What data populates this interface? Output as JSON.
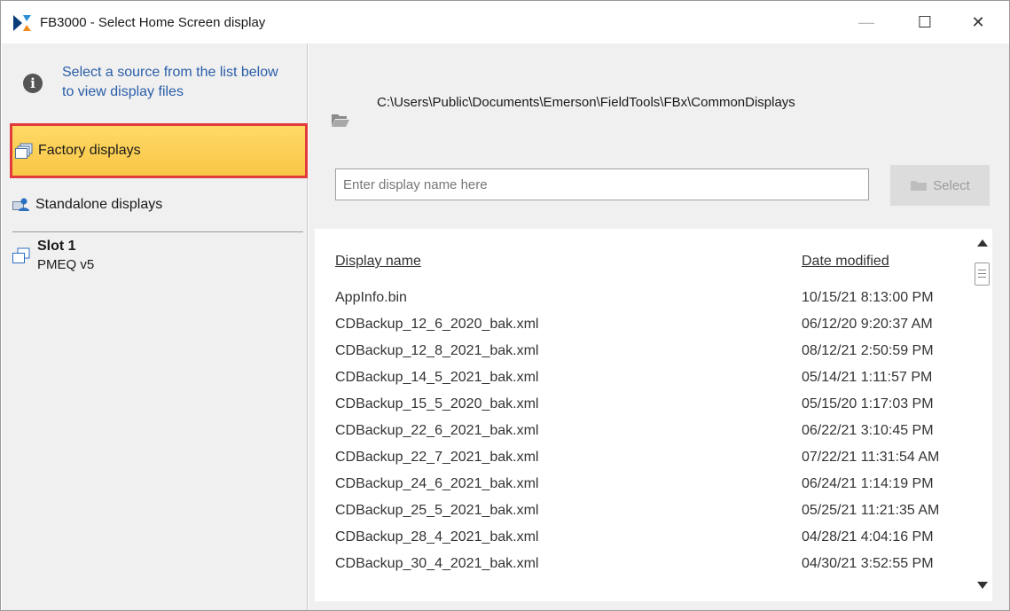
{
  "window": {
    "title": "FB3000 - Select Home Screen display",
    "logo_icon": "emerson-fb-logo-icon",
    "controls": {
      "minimize": "—",
      "maximize": "☐",
      "close": "✕"
    }
  },
  "sidebar": {
    "info_text": "Select a source from the list below to view display files",
    "info_icon": "info-icon",
    "items": [
      {
        "label": "Factory displays",
        "icon": "stacked-windows-icon",
        "selected": true
      },
      {
        "label": "Standalone displays",
        "icon": "user-display-icon",
        "selected": false
      }
    ],
    "slot": {
      "title": "Slot 1",
      "subtitle": "PMEQ v5",
      "icon": "stacked-windows-icon"
    }
  },
  "main": {
    "path": "C:\\Users\\Public\\Documents\\Emerson\\FieldTools\\FBx\\CommonDisplays",
    "search": {
      "placeholder": "Enter display name here",
      "value": ""
    },
    "select_button": {
      "label": "Select",
      "enabled": false
    },
    "columns": {
      "name": "Display name",
      "date": "Date modified"
    },
    "files": [
      {
        "name": "AppInfo.bin",
        "date": "10/15/21 8:13:00 PM"
      },
      {
        "name": "CDBackup_12_6_2020_bak.xml",
        "date": "06/12/20 9:20:37 AM"
      },
      {
        "name": "CDBackup_12_8_2021_bak.xml",
        "date": "08/12/21 2:50:59 PM"
      },
      {
        "name": "CDBackup_14_5_2021_bak.xml",
        "date": "05/14/21 1:11:57 PM"
      },
      {
        "name": "CDBackup_15_5_2020_bak.xml",
        "date": "05/15/20 1:17:03 PM"
      },
      {
        "name": "CDBackup_22_6_2021_bak.xml",
        "date": "06/22/21 3:10:45 PM"
      },
      {
        "name": "CDBackup_22_7_2021_bak.xml",
        "date": "07/22/21 11:31:54 AM"
      },
      {
        "name": "CDBackup_24_6_2021_bak.xml",
        "date": "06/24/21 1:14:19 PM"
      },
      {
        "name": "CDBackup_25_5_2021_bak.xml",
        "date": "05/25/21 11:21:35 AM"
      },
      {
        "name": "CDBackup_28_4_2021_bak.xml",
        "date": "04/28/21 4:04:16 PM"
      },
      {
        "name": "CDBackup_30_4_2021_bak.xml",
        "date": "04/30/21 3:52:55 PM"
      }
    ]
  },
  "colors": {
    "selection_fill": "#f9c646",
    "selection_border": "#e23b3b",
    "info_text": "#2a5ea8",
    "panel_background": "#f0f0f0"
  }
}
